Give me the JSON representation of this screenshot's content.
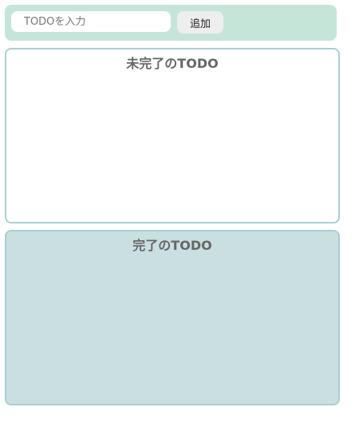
{
  "input_area": {
    "placeholder": "TODOを入力",
    "value": "",
    "add_button_label": "追加"
  },
  "incomplete_area": {
    "title": "未完了のTODO",
    "items": []
  },
  "complete_area": {
    "title": "完了のTODO",
    "items": []
  },
  "colors": {
    "input_area_background": "#c6e5d9",
    "complete_area_background": "#c9dfe0",
    "section_border": "#aacfd0",
    "title_text": "#666666"
  }
}
